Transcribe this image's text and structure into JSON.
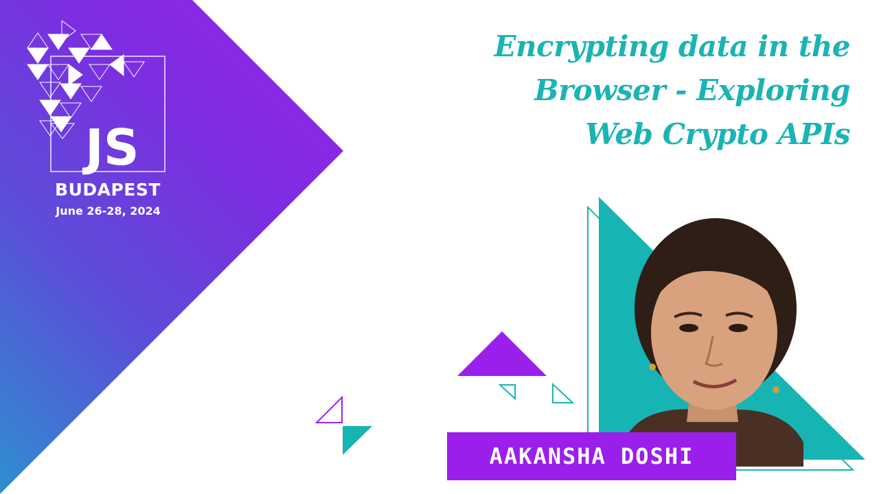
{
  "event": {
    "logo_text": "JS",
    "city": "BUDAPEST",
    "dates": "June 26-28, 2024"
  },
  "talk": {
    "title_lines": [
      "Encrypting data in the",
      "Browser - Exploring",
      "Web Crypto APIs"
    ]
  },
  "speaker": {
    "name": "AAKANSHA DOSHI"
  },
  "colors": {
    "teal": "#1bb3b3",
    "purple": "#9b1fea",
    "gradient_start": "#9a22ea",
    "gradient_end": "#2f8fd0"
  }
}
